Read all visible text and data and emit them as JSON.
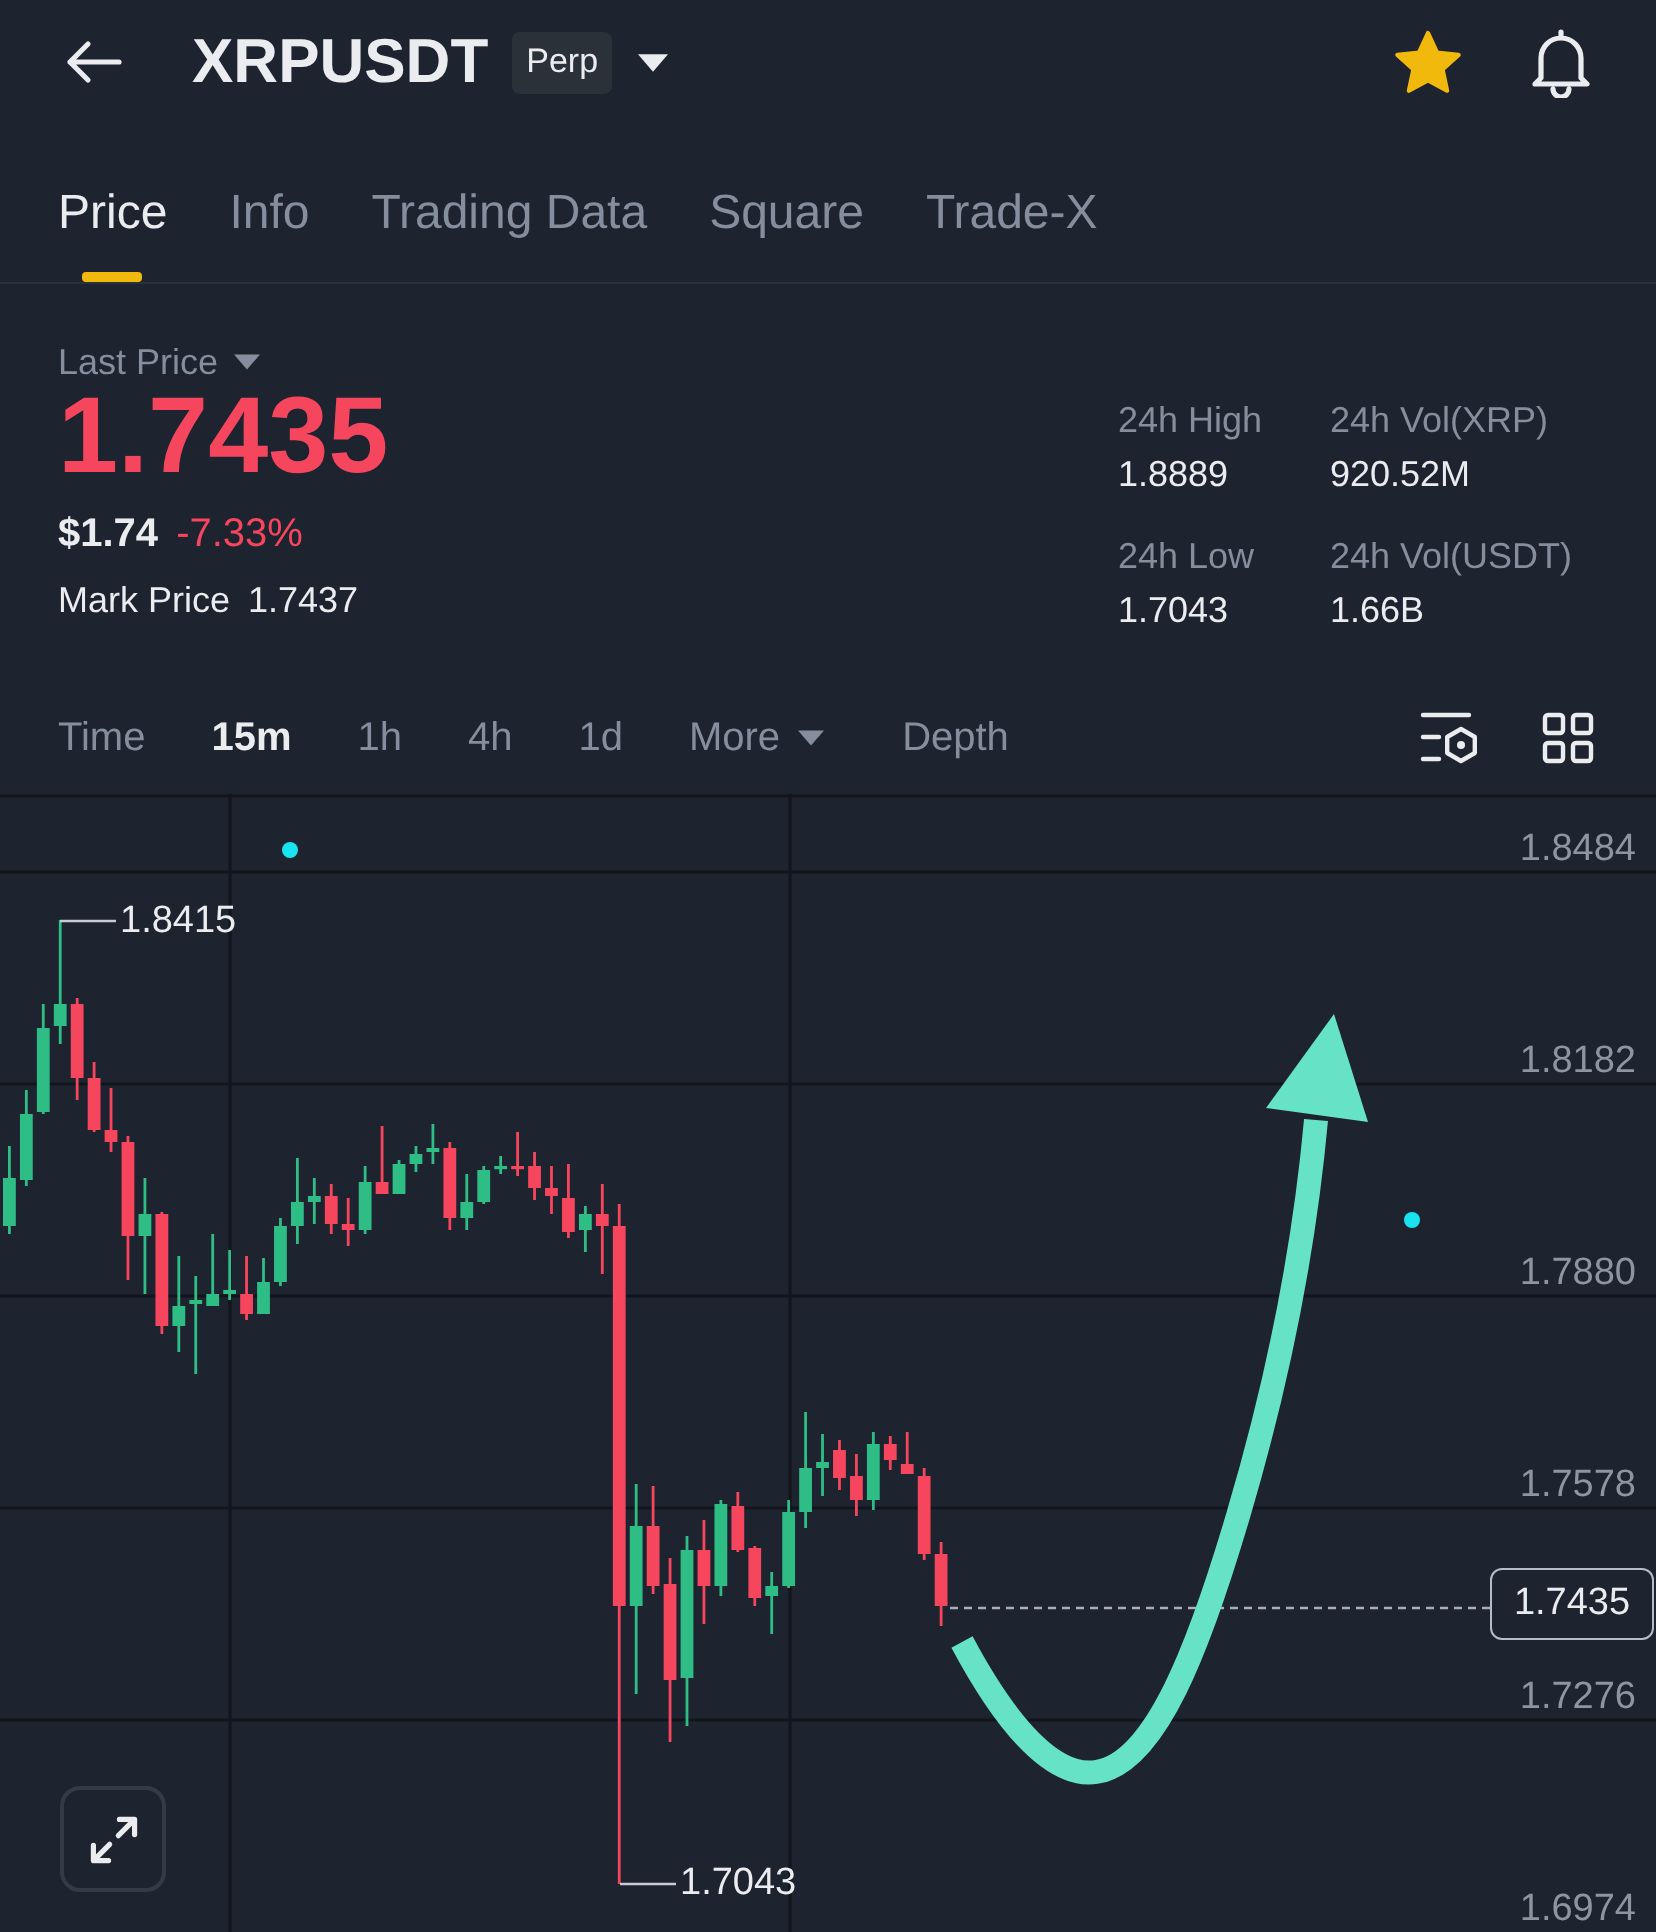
{
  "header": {
    "symbol": "XRPUSDT",
    "badge": "Perp",
    "favorited": true
  },
  "tabs": [
    {
      "label": "Price",
      "selected": true
    },
    {
      "label": "Info",
      "selected": false
    },
    {
      "label": "Trading Data",
      "selected": false
    },
    {
      "label": "Square",
      "selected": false
    },
    {
      "label": "Trade-X",
      "selected": false
    }
  ],
  "price_panel": {
    "last_price_label": "Last Price",
    "last_price": "1.7435",
    "falling": true,
    "usd_price": "$1.74",
    "change": "-7.33%",
    "mark_price_label": "Mark Price",
    "mark_price": "1.7437",
    "stats": [
      {
        "label": "24h High",
        "value": "1.8889"
      },
      {
        "label": "24h Vol(XRP)",
        "value": "920.52M"
      },
      {
        "label": "24h Low",
        "value": "1.7043"
      },
      {
        "label": "24h Vol(USDT)",
        "value": "1.66B"
      }
    ]
  },
  "intervals": [
    {
      "label": "Time",
      "kind": "option",
      "selected": false
    },
    {
      "label": "15m",
      "kind": "option",
      "selected": true
    },
    {
      "label": "1h",
      "kind": "option",
      "selected": false
    },
    {
      "label": "4h",
      "kind": "option",
      "selected": false
    },
    {
      "label": "1d",
      "kind": "option",
      "selected": false
    },
    {
      "label": "More",
      "kind": "dropdown",
      "selected": false
    },
    {
      "label": "Depth",
      "kind": "view",
      "selected": false
    }
  ],
  "chart": {
    "price_ticks": [
      "1.8484",
      "1.8182",
      "1.7880",
      "1.7578",
      "1.7276",
      "1.6974"
    ],
    "high_marker": "1.8415",
    "low_marker": "1.7043",
    "last_price_tag": "1.7435"
  }
}
